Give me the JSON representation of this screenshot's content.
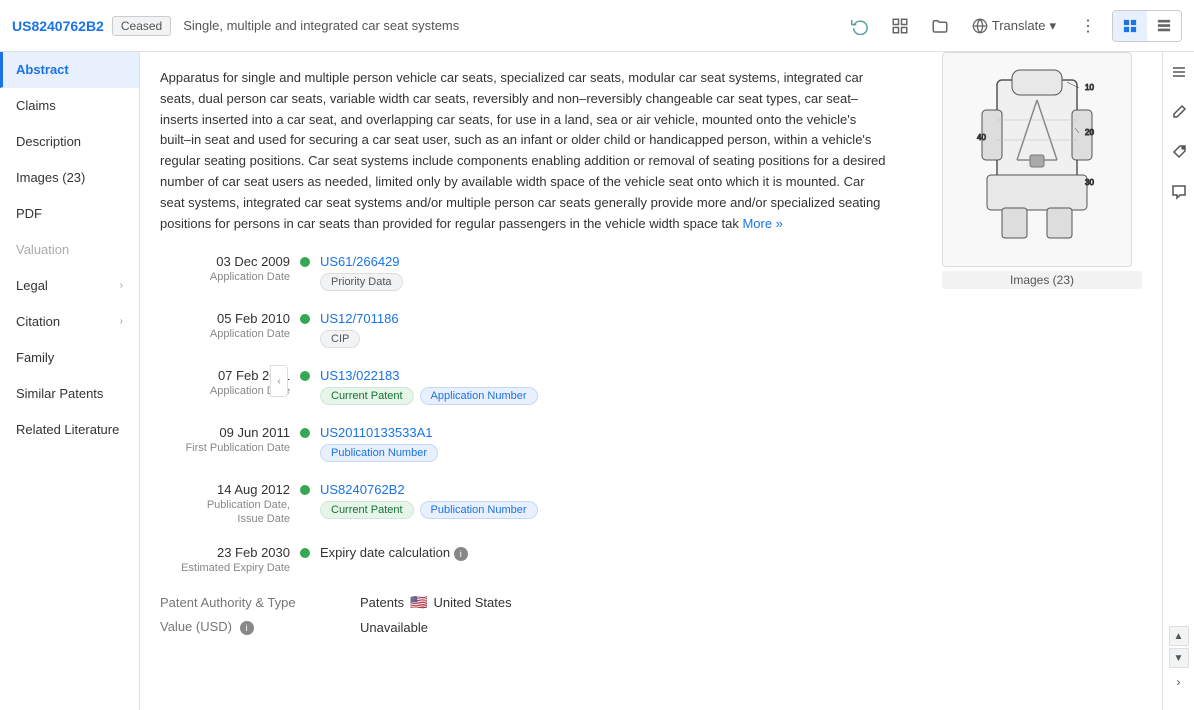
{
  "header": {
    "patent_id": "US8240762B2",
    "status_badge": "Ceased",
    "title": "Single, multiple and integrated car seat systems",
    "translate_label": "Translate",
    "icons": {
      "refresh": "↻",
      "bookmark": "⊞",
      "folder": "📁",
      "translate": "🌐",
      "more": "⋮",
      "grid_view": "▦",
      "list_view": "☰"
    }
  },
  "sidebar": {
    "items": [
      {
        "label": "Abstract",
        "active": true,
        "has_arrow": false
      },
      {
        "label": "Claims",
        "active": false,
        "has_arrow": false
      },
      {
        "label": "Description",
        "active": false,
        "has_arrow": false
      },
      {
        "label": "Images (23)",
        "active": false,
        "has_arrow": false
      },
      {
        "label": "PDF",
        "active": false,
        "has_arrow": false
      },
      {
        "label": "Valuation",
        "active": false,
        "disabled": true,
        "has_arrow": false
      },
      {
        "label": "Legal",
        "active": false,
        "has_arrow": true
      },
      {
        "label": "Citation",
        "active": false,
        "has_arrow": true
      },
      {
        "label": "Family",
        "active": false,
        "has_arrow": false
      },
      {
        "label": "Similar Patents",
        "active": false,
        "has_arrow": false
      },
      {
        "label": "Related Literature",
        "active": false,
        "has_arrow": false
      }
    ]
  },
  "abstract": {
    "text": "Apparatus for single and multiple person vehicle car seats, specialized car seats, modular car seat systems, integrated car seats, dual person car seats, variable width car seats, reversibly and non–reversibly changeable car seat types, car seat–inserts inserted into a car seat, and overlapping car seats, for use in a land, sea or air vehicle, mounted onto the vehicle's built–in seat and used for securing a car seat user, such as an infant or older child or handicapped person, within a vehicle's regular seating positions. Car seat systems include components enabling addition or removal of seating positions for a desired number of car seat users as needed, limited only by available width space of the vehicle seat onto which it is mounted. Car seat systems, integrated car seat systems and/or multiple person car seats generally provide more and/or specialized seating positions for persons in car seats than provided for regular passengers in the vehicle width space tak",
    "more_label": "More »"
  },
  "timeline": {
    "entries": [
      {
        "date": "03 Dec 2009",
        "date_label": "Application Date",
        "patent_link": "US61/266429",
        "tags": [
          "Priority Data"
        ],
        "tag_types": [
          "gray"
        ]
      },
      {
        "date": "05 Feb 2010",
        "date_label": "Application Date",
        "patent_link": "US12/701186",
        "tags": [
          "CIP"
        ],
        "tag_types": [
          "gray"
        ]
      },
      {
        "date": "07 Feb 2011",
        "date_label": "Application Date",
        "patent_link": "US13/022183",
        "tags": [
          "Current Patent",
          "Application Number"
        ],
        "tag_types": [
          "green",
          "blue"
        ]
      },
      {
        "date": "09 Jun 2011",
        "date_label": "First Publication Date",
        "patent_link": "US20110133533A1",
        "tags": [
          "Publication Number"
        ],
        "tag_types": [
          "blue"
        ]
      },
      {
        "date": "14 Aug 2012",
        "date_label": "Publication Date, Issue Date",
        "patent_link": "US8240762B2",
        "tags": [
          "Current Patent",
          "Publication Number"
        ],
        "tag_types": [
          "green",
          "blue"
        ]
      },
      {
        "date": "23 Feb 2030",
        "date_label": "Estimated Expiry Date",
        "special": true,
        "special_text": "Expiry date calculation",
        "has_info": true,
        "patent_link": null,
        "tags": [],
        "tag_types": []
      }
    ]
  },
  "bottom_info": {
    "authority_label": "Patent Authority & Type",
    "authority_value": "Patents",
    "country": "United States",
    "flag": "🇺🇸",
    "value_label": "Value (USD)",
    "value_text": "Unavailable",
    "has_info": true
  },
  "image": {
    "caption": "Images (23)"
  }
}
